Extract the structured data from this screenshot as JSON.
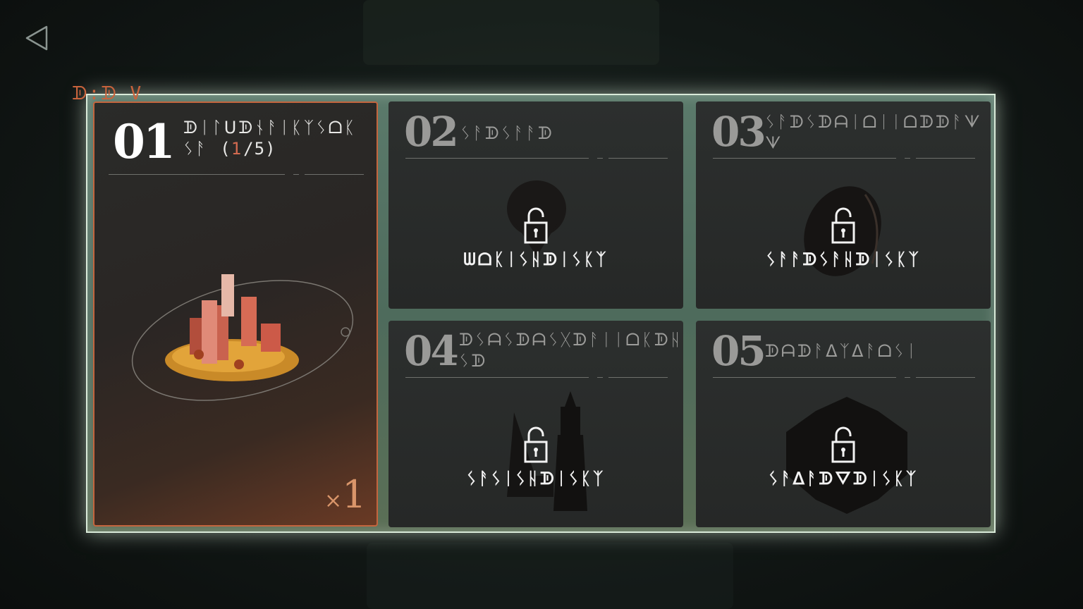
{
  "back_button": {
    "icon": "back-triangle-icon"
  },
  "corner_mark": "ᗫ:ᗫ V",
  "cards": [
    {
      "number": "01",
      "title_line1": "ᗫᛁᛚᑌᗫᚾᚨᛁᛕᛉᛊᗝᛕ",
      "title_line2": "ᛊᚨ",
      "progress_open": "(",
      "progress_current": "1",
      "progress_rest": "/5)",
      "quantity_prefix": "×",
      "quantity": "1",
      "state": "unlocked"
    },
    {
      "number": "02",
      "title": "ᛊᚨᗫᛊᚨᚨᗫ",
      "lock_label": "ᗯᗝᛕᛁᛊᚺᗫᛁᛊᛕᛉ",
      "state": "locked"
    },
    {
      "number": "03",
      "title": "ᛊᚨᗫᛊᗫᗩᛁᗝᛁᛁᗝᗫᗫᚨᗐ ᗐ",
      "lock_label": "ᛊᚨᚨᗫᛊᚨᚺᗫᛁᛊᛕᛉ",
      "state": "locked"
    },
    {
      "number": "04",
      "title": "ᗫᛊᗩᛊᗫᗩᛊᚷᗫᚨᛁᛁᗝᛕᗫᚺᚨ ᛊᗫ",
      "lock_label": "ᛊᚨᛊᛁᛊᚺᗫᛁᛊᛕᛉ",
      "state": "locked"
    },
    {
      "number": "05",
      "title": "ᗫᗩᗫᚨᐃᛉᐃᚨᗝᛊᛁ",
      "lock_label": "ᛊᚨᐃᚨᗫᐁᗫᛁᛊᛕᛉ",
      "state": "locked"
    }
  ],
  "colors": {
    "frame": "#d9ead9",
    "accent": "#c4653e",
    "count": "#d26a50"
  }
}
